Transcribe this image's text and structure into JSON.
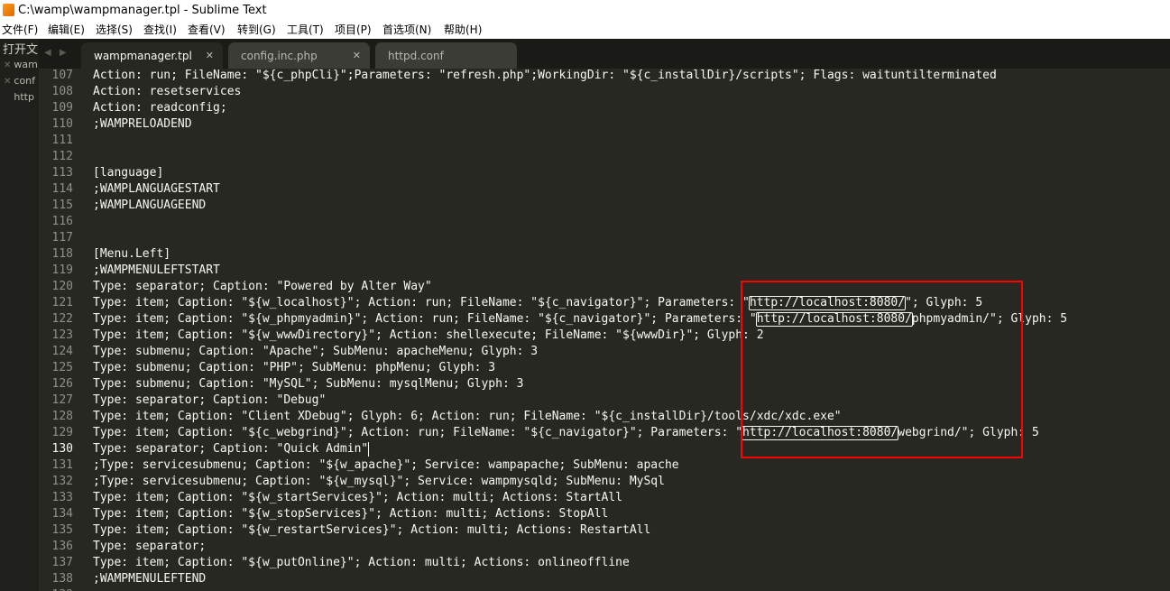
{
  "window": {
    "title": "C:\\wamp\\wampmanager.tpl - Sublime Text"
  },
  "menu": [
    "文件(F)",
    "编辑(E)",
    "选择(S)",
    "查找(I)",
    "查看(V)",
    "转到(G)",
    "工具(T)",
    "项目(P)",
    "首选项(N)",
    "帮助(H)"
  ],
  "sidebar": {
    "header": "打开文",
    "files": [
      "wam",
      "conf",
      "http"
    ]
  },
  "tabs": [
    {
      "label": "wampmanager.tpl",
      "active": true
    },
    {
      "label": "config.inc.php",
      "active": false
    },
    {
      "label": "httpd.conf",
      "active": false
    }
  ],
  "editor": {
    "current_line": 130,
    "lines": [
      {
        "n": "107",
        "text": "Action: run; FileName: \"${c_phpCli}\";Parameters: \"refresh.php\";WorkingDir: \"${c_installDir}/scripts\"; Flags: waituntilterminated"
      },
      {
        "n": "108",
        "text": "Action: resetservices"
      },
      {
        "n": "109",
        "text": "Action: readconfig;"
      },
      {
        "n": "110",
        "text": ";WAMPRELOADEND"
      },
      {
        "n": "111",
        "text": ""
      },
      {
        "n": "112",
        "text": ""
      },
      {
        "n": "113",
        "text": "[language]"
      },
      {
        "n": "114",
        "text": ";WAMPLANGUAGESTART"
      },
      {
        "n": "115",
        "text": ";WAMPLANGUAGEEND"
      },
      {
        "n": "116",
        "text": ""
      },
      {
        "n": "117",
        "text": ""
      },
      {
        "n": "118",
        "text": "[Menu.Left]"
      },
      {
        "n": "119",
        "text": ";WAMPMENULEFTSTART"
      },
      {
        "n": "120",
        "text": "Type: separator; Caption: \"Powered by Alter Way\""
      },
      {
        "n": "121",
        "text": "Type: item; Caption: \"${w_localhost}\"; Action: run; FileName: \"${c_navigator}\"; Parameters: \"http://localhost:8080/\"; Glyph: 5"
      },
      {
        "n": "122",
        "text": "Type: item; Caption: \"${w_phpmyadmin}\"; Action: run; FileName: \"${c_navigator}\"; Parameters: \"http://localhost:8080/phpmyadmin/\"; Glyph: 5"
      },
      {
        "n": "123",
        "text": "Type: item; Caption: \"${w_wwwDirectory}\"; Action: shellexecute; FileName: \"${wwwDir}\"; Glyph: 2"
      },
      {
        "n": "124",
        "text": "Type: submenu; Caption: \"Apache\"; SubMenu: apacheMenu; Glyph: 3"
      },
      {
        "n": "125",
        "text": "Type: submenu; Caption: \"PHP\"; SubMenu: phpMenu; Glyph: 3"
      },
      {
        "n": "126",
        "text": "Type: submenu; Caption: \"MySQL\"; SubMenu: mysqlMenu; Glyph: 3"
      },
      {
        "n": "127",
        "text": "Type: separator; Caption: \"Debug\""
      },
      {
        "n": "128",
        "text": "Type: item; Caption: \"Client XDebug\"; Glyph: 6; Action: run; FileName: \"${c_installDir}/tools/xdc/xdc.exe\""
      },
      {
        "n": "129",
        "text": "Type: item; Caption: \"${c_webgrind}\"; Action: run; FileName: \"${c_navigator}\"; Parameters: \"http://localhost:8080/webgrind/\"; Glyph: 5"
      },
      {
        "n": "130",
        "text": "Type: separator; Caption: \"Quick Admin\""
      },
      {
        "n": "131",
        "text": ";Type: servicesubmenu; Caption: \"${w_apache}\"; Service: wampapache; SubMenu: apache"
      },
      {
        "n": "132",
        "text": ";Type: servicesubmenu; Caption: \"${w_mysql}\"; Service: wampmysqld; SubMenu: MySql"
      },
      {
        "n": "133",
        "text": "Type: item; Caption: \"${w_startServices}\"; Action: multi; Actions: StartAll"
      },
      {
        "n": "134",
        "text": "Type: item; Caption: \"${w_stopServices}\"; Action: multi; Actions: StopAll"
      },
      {
        "n": "135",
        "text": "Type: item; Caption: \"${w_restartServices}\"; Action: multi; Actions: RestartAll"
      },
      {
        "n": "136",
        "text": "Type: separator;"
      },
      {
        "n": "137",
        "text": "Type: item; Caption: \"${w_putOnline}\"; Action: multi; Actions: onlineoffline"
      },
      {
        "n": "138",
        "text": ";WAMPMENULEFTEND"
      },
      {
        "n": "139",
        "text": ""
      }
    ]
  },
  "colors": {
    "editor_background": "#272822",
    "foreground": "#f8f8f2",
    "gutter": "#90908a",
    "annotation": "#ff0000"
  }
}
